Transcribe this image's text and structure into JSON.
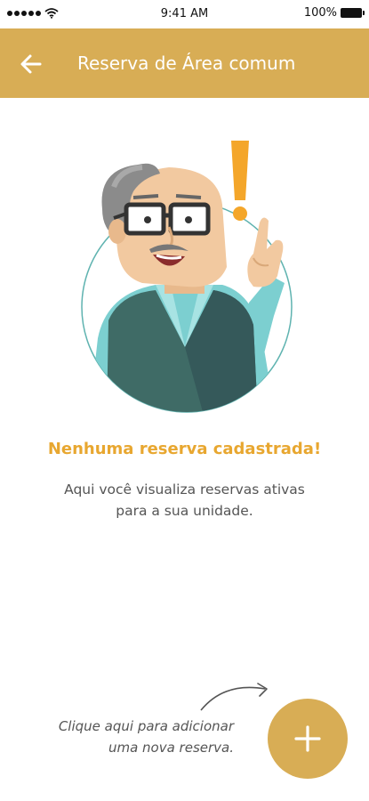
{
  "status_bar": {
    "time": "9:41 AM",
    "battery": "100%"
  },
  "header": {
    "title": "Reserva de Área comum",
    "back_icon": "arrow-left-icon"
  },
  "empty_state": {
    "illustration": "old-man-pointing-illustration",
    "title": "Nenhuma reserva cadastrada!",
    "description_line1": "Aqui você visualiza reservas ativas",
    "description_line2": "para a sua unidade."
  },
  "hint": {
    "line1": "Clique aqui para adicionar",
    "line2": "uma nova reserva."
  },
  "fab": {
    "icon": "plus-icon"
  },
  "colors": {
    "brand": "#d8ad55",
    "accent_title": "#e8a730",
    "text": "#555555"
  }
}
